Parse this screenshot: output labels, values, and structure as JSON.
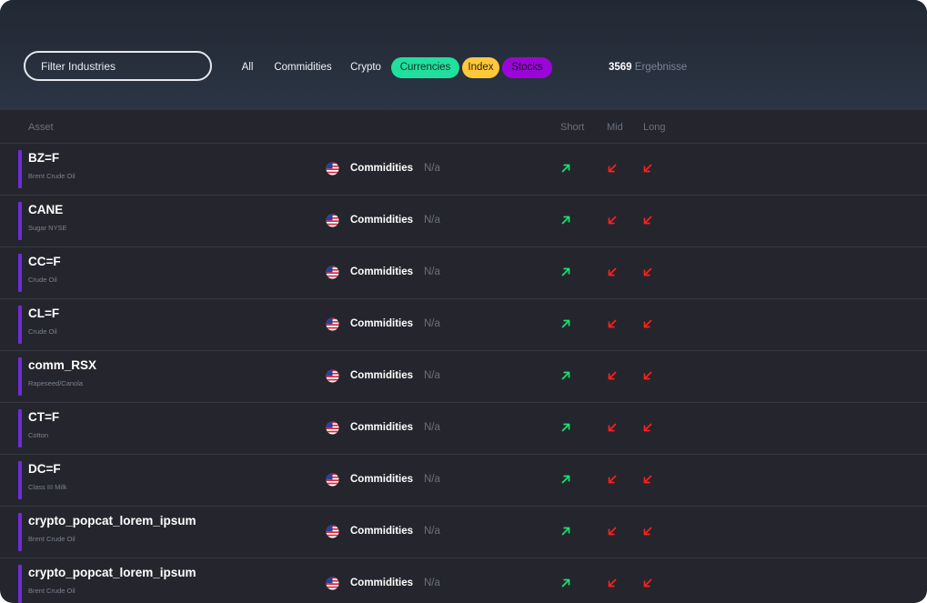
{
  "filter": {
    "placeholder": "Filter Industries"
  },
  "chips": [
    {
      "label": "All"
    },
    {
      "label": "Commidities"
    },
    {
      "label": "Crypto"
    },
    {
      "label": "Currencies"
    },
    {
      "label": "Index"
    },
    {
      "label": "Stocks"
    }
  ],
  "results": {
    "count": "3569",
    "label": "Ergebnisse"
  },
  "columns": {
    "asset": "Asset",
    "short": "Short",
    "mid": "Mid",
    "long": "Long"
  },
  "colors": {
    "accent_bar": "#6f2bd9",
    "up": "#19e36f",
    "down": "#ff1f1f",
    "currencies": "#1fe09c",
    "index": "#ffc83a",
    "stocks": "#9b06d8"
  },
  "rows": [
    {
      "symbol": "BZ=F",
      "name": "Brent Crude Oil",
      "flag": "us-flag-icon",
      "category": "Commidities",
      "type": "N/a",
      "short": "up",
      "mid": "down",
      "long": "down"
    },
    {
      "symbol": "CANE",
      "name": "Sugar NYSE",
      "flag": "us-flag-icon",
      "category": "Commidities",
      "type": "N/a",
      "short": "up",
      "mid": "down",
      "long": "down"
    },
    {
      "symbol": "CC=F",
      "name": "Crude Oil",
      "flag": "us-flag-icon",
      "category": "Commidities",
      "type": "N/a",
      "short": "up",
      "mid": "down",
      "long": "down"
    },
    {
      "symbol": "CL=F",
      "name": "Crude Oil",
      "flag": "us-flag-icon",
      "category": "Commidities",
      "type": "N/a",
      "short": "up",
      "mid": "down",
      "long": "down"
    },
    {
      "symbol": "comm_RSX",
      "name": "Rapeseed/Canola",
      "flag": "us-flag-icon",
      "category": "Commidities",
      "type": "N/a",
      "short": "up",
      "mid": "down",
      "long": "down"
    },
    {
      "symbol": "CT=F",
      "name": "Cotton",
      "flag": "us-flag-icon",
      "category": "Commidities",
      "type": "N/a",
      "short": "up",
      "mid": "down",
      "long": "down"
    },
    {
      "symbol": "DC=F",
      "name": "Class III Milk",
      "flag": "us-flag-icon",
      "category": "Commidities",
      "type": "N/a",
      "short": "up",
      "mid": "down",
      "long": "down"
    },
    {
      "symbol": "crypto_popcat_lorem_ipsum",
      "name": "Brent Crude Oil",
      "flag": "us-flag-icon",
      "category": "Commidities",
      "type": "N/a",
      "short": "up",
      "mid": "down",
      "long": "down"
    },
    {
      "symbol": "crypto_popcat_lorem_ipsum",
      "name": "Brent Crude Oil",
      "flag": "us-flag-icon",
      "category": "Commidities",
      "type": "N/a",
      "short": "up",
      "mid": "down",
      "long": "down"
    }
  ]
}
